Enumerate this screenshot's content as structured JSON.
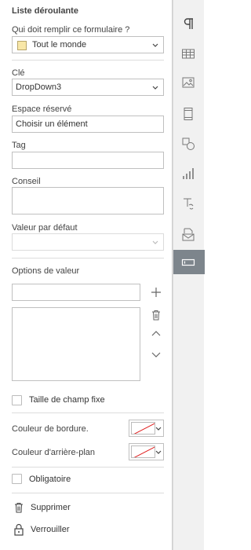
{
  "panel": {
    "title": "Liste déroulante",
    "who_fills": {
      "label": "Qui doit remplir ce formulaire ?",
      "value": "Tout le monde",
      "swatch_color": "#f8e7a8"
    },
    "key": {
      "label": "Clé",
      "value": "DropDown3"
    },
    "placeholder": {
      "label": "Espace réservé",
      "value": "Choisir un élément"
    },
    "tag": {
      "label": "Tag",
      "value": ""
    },
    "tip": {
      "label": "Conseil",
      "value": ""
    },
    "default_value": {
      "label": "Valeur par défaut",
      "value": ""
    },
    "value_options": {
      "label": "Options de valeur",
      "input_value": "",
      "items": []
    },
    "fixed_size": {
      "label": "Taille de champ fixe",
      "checked": false
    },
    "border_color": {
      "label": "Couleur de bordure."
    },
    "background_color": {
      "label": "Couleur d'arrière-plan"
    },
    "required": {
      "label": "Obligatoire",
      "checked": false
    },
    "delete_label": "Supprimer",
    "lock_label": "Verrouiller"
  },
  "rail": {
    "items": [
      {
        "icon": "paragraph-icon",
        "active": false
      },
      {
        "icon": "table-icon",
        "active": false
      },
      {
        "icon": "image-icon",
        "active": false
      },
      {
        "icon": "header-footer-icon",
        "active": false
      },
      {
        "icon": "shape-icon",
        "active": false
      },
      {
        "icon": "chart-icon",
        "active": false
      },
      {
        "icon": "text-art-icon",
        "active": false
      },
      {
        "icon": "mail-merge-icon",
        "active": false
      },
      {
        "icon": "form-settings-icon",
        "active": true
      }
    ]
  },
  "colors": {
    "rail_active": "#7d858c",
    "no_color_line": "#e02020"
  }
}
